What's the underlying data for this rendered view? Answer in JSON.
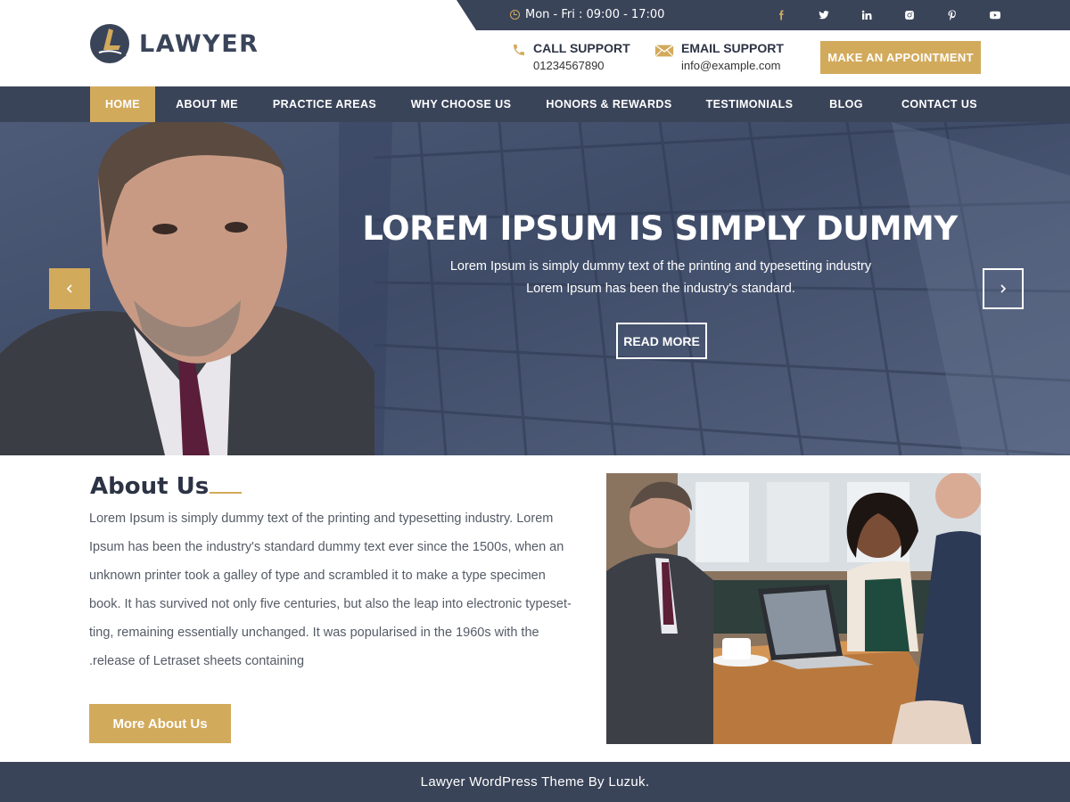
{
  "topbar": {
    "hours": "Mon - Fri : 09:00 - 17:00",
    "socials": [
      "facebook-icon",
      "twitter-icon",
      "linkedin-icon",
      "instagram-icon",
      "pinterest-icon",
      "youtube-icon"
    ]
  },
  "logo": {
    "text": "LAWYER"
  },
  "contact": {
    "call_title": "CALL SUPPORT",
    "call_value": "01234567890",
    "email_title": "EMAIL SUPPORT",
    "email_value": "info@example.com"
  },
  "appointment_label": "MAKE AN APPOINTMENT",
  "nav": {
    "items": [
      "HOME",
      "ABOUT ME",
      "PRACTICE AREAS",
      "WHY CHOOSE US",
      "HONORS & REWARDS",
      "TESTIMONIALS",
      "BLOG",
      "CONTACT US"
    ],
    "active": "HOME"
  },
  "hero": {
    "title": "LOREM IPSUM IS SIMPLY DUMMY",
    "subtitle_line1": "Lorem Ipsum is simply dummy text of the printing and typesetting industry",
    "subtitle_line2": "Lorem Ipsum has been the industry's standard.",
    "button": "READ MORE"
  },
  "about": {
    "title": "About Us",
    "lines": [
      "Lorem Ipsum is simply dummy text of the printing and typesetting industry. Lorem",
      "Ipsum has been the industry's standard dummy text ever since the 1500s, when an",
      "unknown printer took a galley of type and scrambled it to make a type specimen",
      "book. It has survived not only five centuries, but also the leap into electronic typeset-",
      "ting, remaining essentially unchanged. It was popularised in the 1960s with the",
      ".release of Letraset sheets containing"
    ],
    "button": "More About Us"
  },
  "footer": {
    "text": "Lawyer WordPress Theme By Luzuk."
  },
  "colors": {
    "navy": "#3a4459",
    "gold": "#d2aa5c",
    "white": "#ffffff"
  }
}
